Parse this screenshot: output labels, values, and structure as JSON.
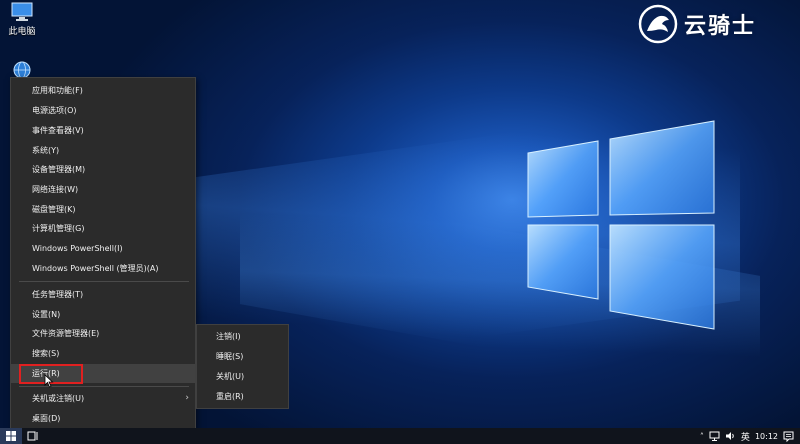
{
  "desktop": {
    "icons": [
      {
        "label": "此电脑"
      }
    ]
  },
  "brand": {
    "text": "云骑士"
  },
  "menu": {
    "group1": [
      {
        "label": "应用和功能(F)"
      },
      {
        "label": "电源选项(O)"
      },
      {
        "label": "事件查看器(V)"
      },
      {
        "label": "系统(Y)"
      },
      {
        "label": "设备管理器(M)"
      },
      {
        "label": "网络连接(W)"
      },
      {
        "label": "磁盘管理(K)"
      },
      {
        "label": "计算机管理(G)"
      },
      {
        "label": "Windows PowerShell(I)"
      },
      {
        "label": "Windows PowerShell (管理员)(A)"
      }
    ],
    "group2": [
      {
        "label": "任务管理器(T)"
      },
      {
        "label": "设置(N)"
      },
      {
        "label": "文件资源管理器(E)"
      },
      {
        "label": "搜索(S)"
      },
      {
        "label": "运行(R)"
      }
    ],
    "group3": [
      {
        "label": "关机或注销(U)"
      },
      {
        "label": "桌面(D)"
      }
    ],
    "hovered": "运行(R)"
  },
  "submenu": {
    "items": [
      {
        "label": "注销(I)"
      },
      {
        "label": "睡眠(S)"
      },
      {
        "label": "关机(U)"
      },
      {
        "label": "重启(R)"
      }
    ]
  },
  "taskbar": {
    "language": "英",
    "time": "10:12"
  },
  "colors": {
    "menu_bg": "#2b2b2b",
    "highlight_border": "#e02020",
    "taskbar_bg": "#10141c"
  }
}
